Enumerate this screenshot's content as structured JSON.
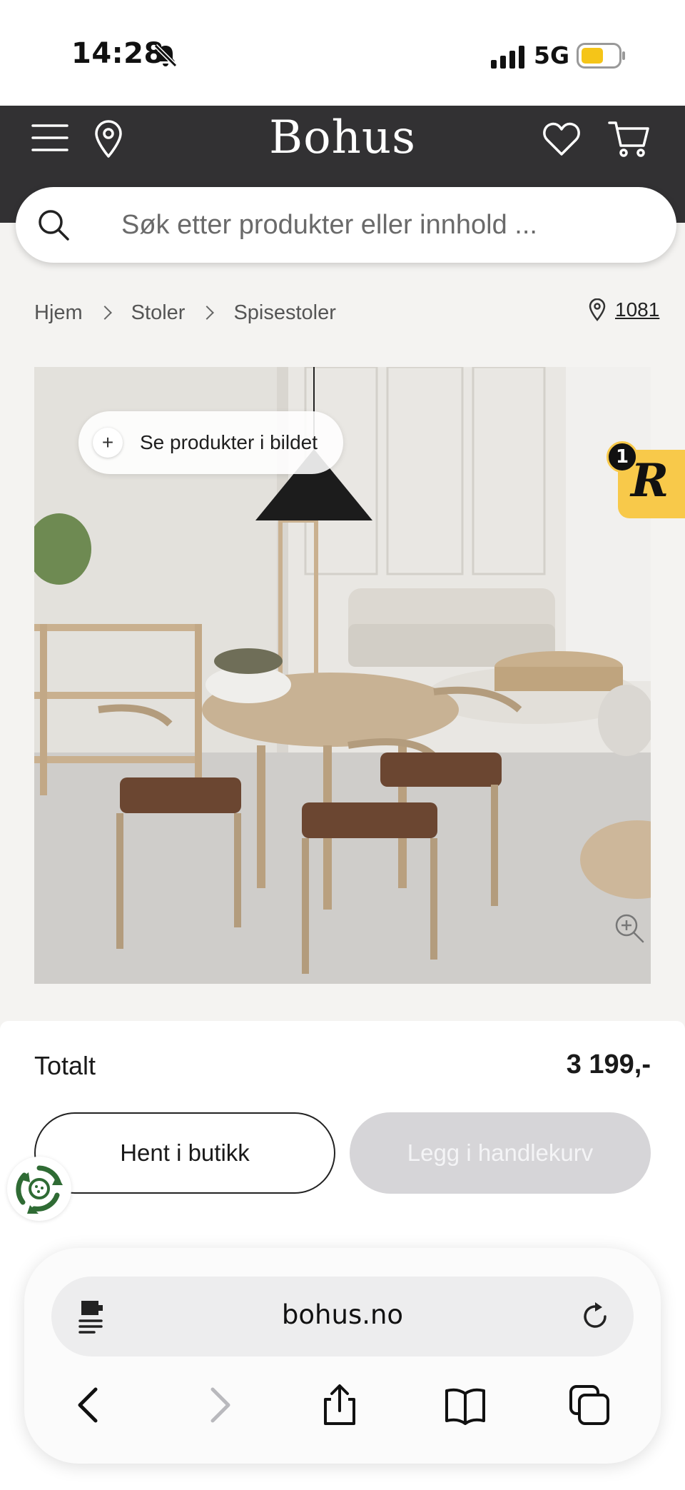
{
  "status_bar": {
    "time": "14:28",
    "network": "5G",
    "battery_color": "#f5c518"
  },
  "header": {
    "brand": "Bohus",
    "background": "#323133"
  },
  "search": {
    "placeholder": "Søk etter produkter eller innhold ..."
  },
  "breadcrumb": {
    "items": [
      "Hjem",
      "Stoler",
      "Spisestoler"
    ]
  },
  "store": {
    "id": "1081"
  },
  "product_image": {
    "see_products_label": "Se produkter i bildet",
    "icons": [
      "plus-icon",
      "zoom-in-icon"
    ]
  },
  "rewards_widget": {
    "badge_count": "1",
    "letter": "R",
    "color": "#f8c94a"
  },
  "cart_summary": {
    "total_label": "Totalt",
    "total_value": "3 199,-",
    "pickup_label": "Hent i butikk",
    "add_to_cart_label": "Legg i handlekurv"
  },
  "browser": {
    "url": "bohus.no",
    "nav_icons": [
      "back-icon",
      "forward-icon",
      "share-icon",
      "bookmarks-icon",
      "tabs-icon"
    ]
  }
}
